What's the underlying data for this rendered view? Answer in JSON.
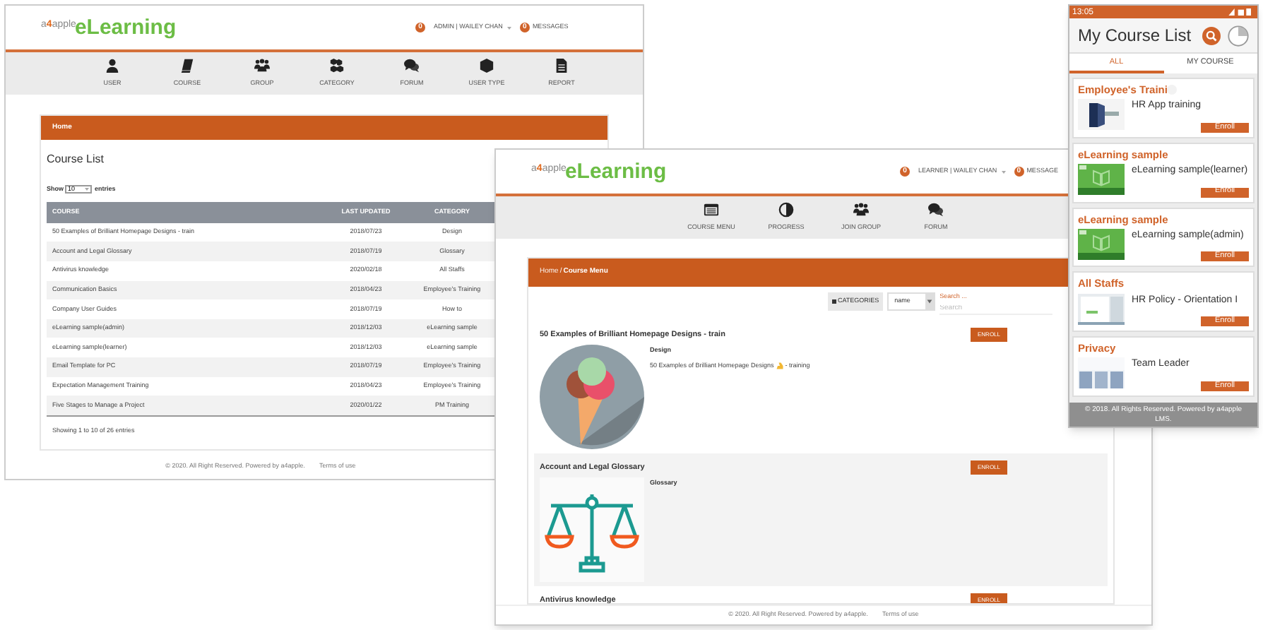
{
  "admin_window": {
    "logo": {
      "brand": "a**4**apple",
      "product": "eLearning"
    },
    "notification_count": "0",
    "user": "ADMIN | WAILEY CHAN",
    "message_count": "0",
    "messages": "MESSAGES",
    "nav": [
      {
        "label": "USER",
        "kind": "user"
      },
      {
        "label": "COURSE",
        "kind": "book"
      },
      {
        "label": "GROUP",
        "kind": "group"
      },
      {
        "label": "CATEGORY",
        "kind": "cubes"
      },
      {
        "label": "FORUM",
        "kind": "chat"
      },
      {
        "label": "USER TYPE",
        "kind": "cube"
      },
      {
        "label": "REPORT",
        "kind": "document"
      }
    ],
    "breadcrumb": "Home",
    "panel_title": "Course List",
    "length": {
      "show": "Show",
      "value": "10",
      "entries": "entries"
    },
    "table": {
      "columns": [
        "COURSE",
        "LAST UPDATED",
        "CATEGORY"
      ],
      "rows": [
        [
          "50 Examples of Brilliant Homepage Designs - train",
          "2018/07/23",
          "Design"
        ],
        [
          "Account and Legal Glossary",
          "2018/07/19",
          "Glossary"
        ],
        [
          "Antivirus knowledge",
          "2020/02/18",
          "All Staffs"
        ],
        [
          "Communication Basics",
          "2018/04/23",
          "Employee's Training"
        ],
        [
          "Company User Guides",
          "2018/07/19",
          "How to"
        ],
        [
          "eLearning sample(admin)",
          "2018/12/03",
          "eLearning sample"
        ],
        [
          "eLearning sample(learner)",
          "2018/12/03",
          "eLearning sample"
        ],
        [
          "Email Template for PC",
          "2018/07/19",
          "Employee's Training"
        ],
        [
          "Expectation Management Training",
          "2018/04/23",
          "Employee's Training"
        ],
        [
          "Five Stages to Manage a Project",
          "2020/01/22",
          "PM Training"
        ]
      ]
    },
    "info": "Showing 1 to 10 of 26 entries",
    "footer": {
      "copyright": "© 2020. All Right Reserved. Powered by a4apple.",
      "link": "Terms of use"
    }
  },
  "learner_window": {
    "logo": {
      "brand": "a**4**apple",
      "product": "eLearning"
    },
    "notification_count": "0",
    "user": "LEARNER | WAILEY CHAN",
    "message_count": "0",
    "messages": "MESSAGE",
    "nav": [
      {
        "label": "COURSE MENU",
        "kind": "course_menu"
      },
      {
        "label": "PROGRESS",
        "kind": "progress"
      },
      {
        "label": "JOIN GROUP",
        "kind": "group"
      },
      {
        "label": "FORUM",
        "kind": "chat"
      }
    ],
    "breadcrumb": [
      {
        "label": "Home",
        "current": false
      },
      {
        "label": "Course Menu",
        "current": true
      }
    ],
    "breadcrumb_separator": "/",
    "toolbar": {
      "categories": "CATEGORIES",
      "sort": "name",
      "search_label": "Search ...",
      "search_placeholder": "Search"
    },
    "courses": [
      {
        "title": "50 Examples of Brilliant Homepage Designs - train",
        "kind": "ice_cream",
        "category": "Design",
        "description": [
          "50 Examples of Brilliant Homepage Designs",
          "- training"
        ],
        "button": "ENROLL"
      },
      {
        "title": "Account and Legal Glossary",
        "kind": "scales",
        "category": "Glossary",
        "button": "ENROLL"
      },
      {
        "title": "Antivirus knowledge",
        "button": "ENROLL"
      }
    ],
    "footer": {
      "copyright": "© 2020. All Right Reserved. Powered by a4apple.",
      "link": "Terms of use"
    }
  },
  "mobile_app": {
    "time": "13:05",
    "title": "My Course List",
    "tabs": [
      {
        "label": "ALL",
        "selected": true
      },
      {
        "label": "MY COURSE",
        "selected": false
      }
    ],
    "cards": [
      {
        "category": "Employee's Traini",
        "title": "HR App training",
        "kind": "door",
        "button": "Enroll"
      },
      {
        "category": "eLearning sample",
        "title": "eLearning sample(learner)",
        "kind": "book",
        "button": "Enroll"
      },
      {
        "category": "eLearning sample",
        "title": "eLearning sample(admin)",
        "kind": "book",
        "button": "Enroll"
      },
      {
        "category": "All Staffs",
        "title": "HR Policy  - Orientation I",
        "kind": "screen",
        "button": "Enroll"
      },
      {
        "category": "Privacy",
        "title": "Team Leader",
        "kind": "pattern",
        "button": "Enroll"
      }
    ],
    "footer": "© 2018. All Rights Reserved. Powered by a4apple LMS."
  }
}
